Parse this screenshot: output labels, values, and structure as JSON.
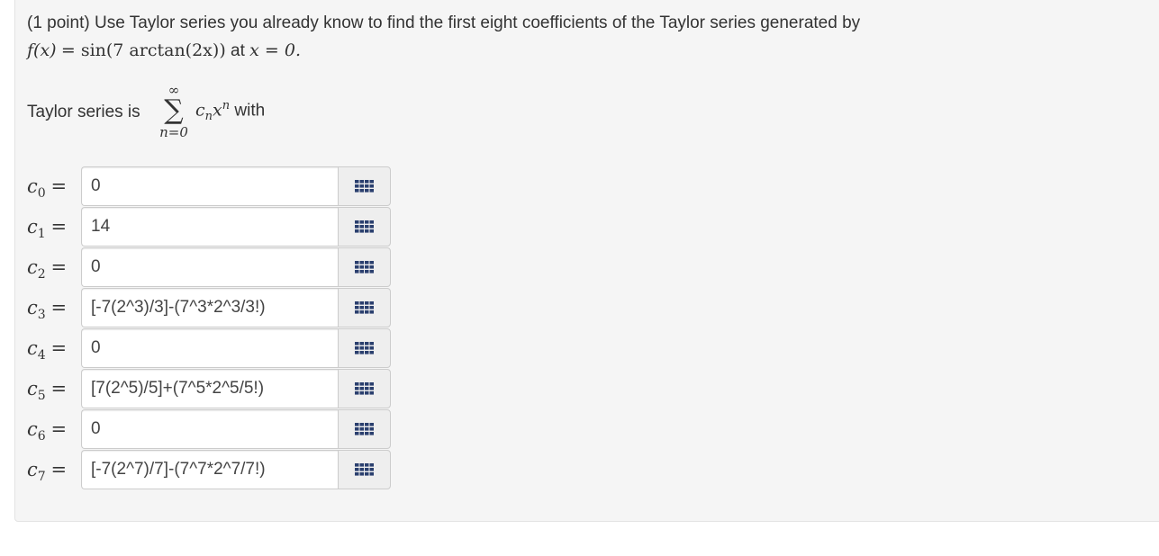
{
  "problem": {
    "line1": "(1 point) Use Taylor series you already know to find the first eight coefficients of the Taylor series generated by",
    "function_lhs": "f(x)",
    "function_rhs": "sin(7 arctan(2x))",
    "at_text": "at",
    "point": "x = 0."
  },
  "series": {
    "prefix": "Taylor series is",
    "sum_upper": "∞",
    "sum_lower": "n=0",
    "term": "c",
    "term_sub": "n",
    "term_var": "x",
    "term_sup": "n",
    "suffix": "with"
  },
  "coefficients": [
    {
      "sym": "c",
      "idx": "0",
      "value": "0"
    },
    {
      "sym": "c",
      "idx": "1",
      "value": "14"
    },
    {
      "sym": "c",
      "idx": "2",
      "value": "0"
    },
    {
      "sym": "c",
      "idx": "3",
      "value": "[-7(2^3)/3]-(7^3*2^3/3!)"
    },
    {
      "sym": "c",
      "idx": "4",
      "value": "0"
    },
    {
      "sym": "c",
      "idx": "5",
      "value": "[7(2^5)/5]+(7^5*2^5/5!)"
    },
    {
      "sym": "c",
      "idx": "6",
      "value": "0"
    },
    {
      "sym": "c",
      "idx": "7",
      "value": "[-7(2^7)/7]-(7^7*2^7/7!)"
    }
  ],
  "icons": {
    "equation_editor": "keypad-icon"
  },
  "colors": {
    "panel_bg": "#f5f5f5",
    "button_bg": "#eeeeee",
    "icon": "#2a3f6e"
  }
}
